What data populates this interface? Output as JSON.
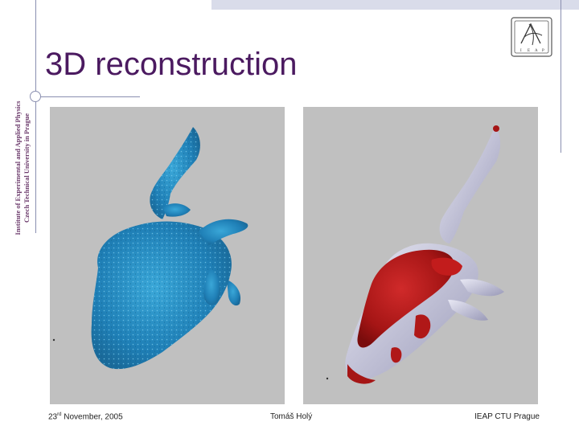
{
  "slide": {
    "title": "3D reconstruction",
    "side_text": {
      "line1": "Institute of Experimental and Applied Physics",
      "line2": "Czech Technical University in Prague"
    },
    "logo_letters": [
      "I",
      "E",
      "A",
      "P"
    ]
  },
  "footer": {
    "date_day": "23",
    "date_suffix": "rd",
    "date_rest": " November, 2005",
    "author": "Tomáš Holý",
    "institution": "IEAP CTU Prague"
  },
  "colors": {
    "title": "#4b1a60",
    "panel_bg": "#c0c0c0",
    "left_model": "#2a8fc4",
    "right_model_red": "#b41818",
    "right_model_white": "#d8d8e8"
  }
}
